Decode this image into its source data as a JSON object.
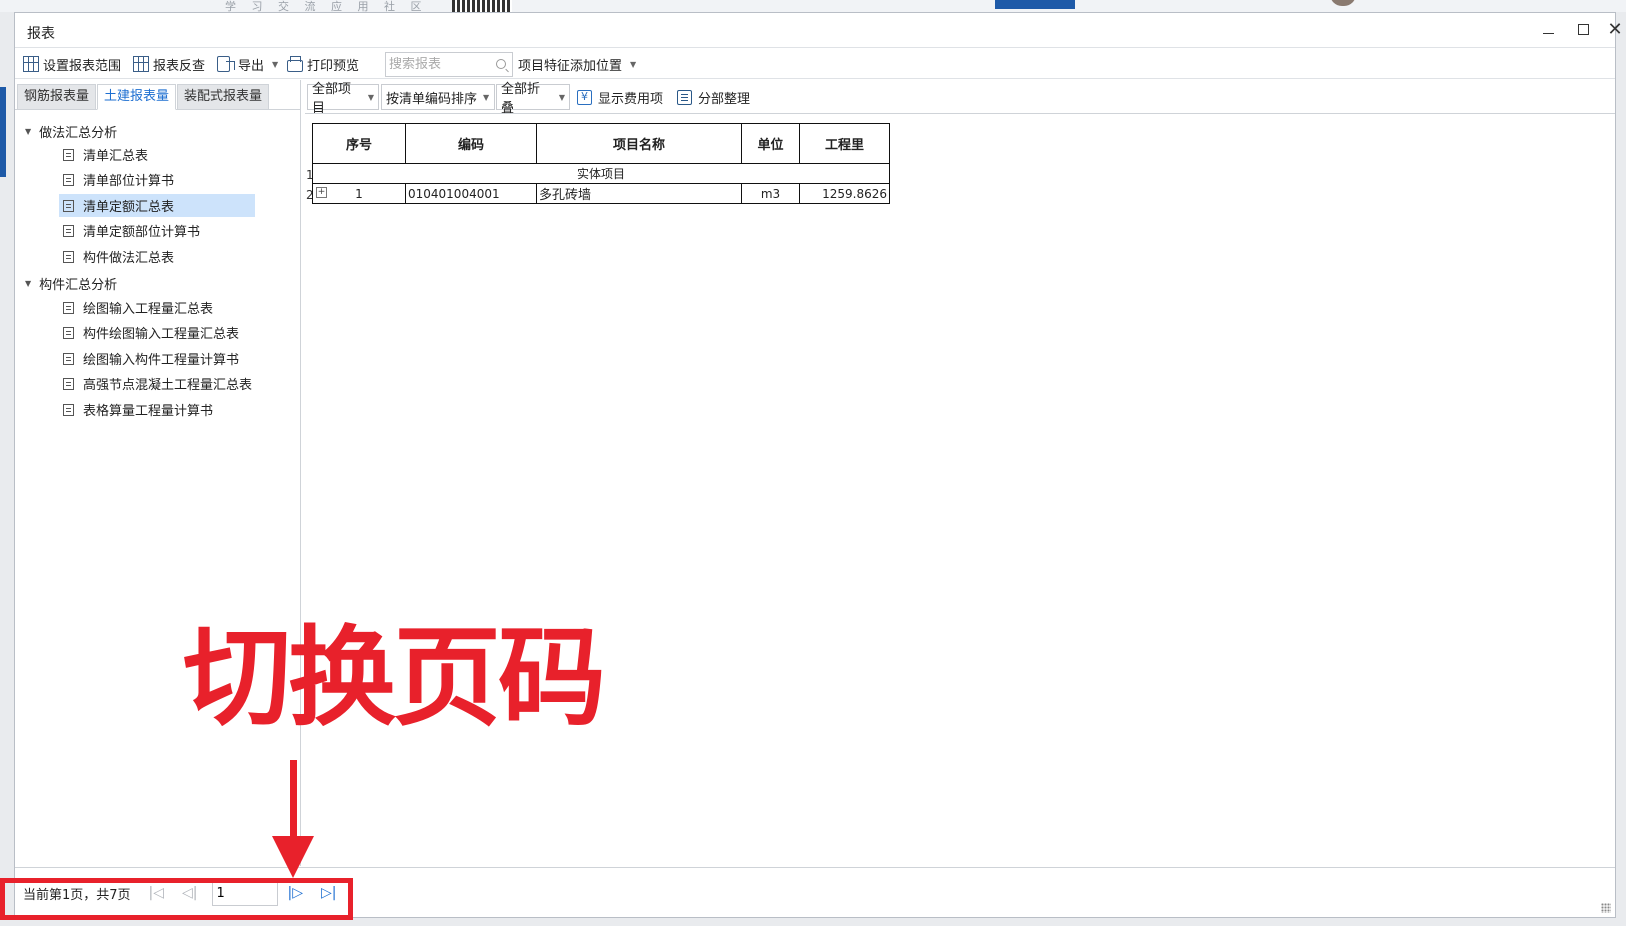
{
  "background": {
    "top_text": "学 习 交 流 应 用 社 区"
  },
  "window": {
    "title": "报表",
    "controls": {
      "minimize": "minimize",
      "maximize": "maximize",
      "close": "close"
    }
  },
  "toolbar": {
    "set_range": "设置报表范围",
    "reverse_check": "报表反查",
    "export": "导出",
    "print_preview": "打印预览",
    "search_placeholder": "搜索报表",
    "feature_position": "项目特征添加位置"
  },
  "tabs": [
    "钢筋报表量",
    "土建报表量",
    "装配式报表量"
  ],
  "tree": {
    "group1": {
      "label": "做法汇总分析",
      "items": [
        "清单汇总表",
        "清单部位计算书",
        "清单定额汇总表",
        "清单定额部位计算书",
        "构件做法汇总表"
      ]
    },
    "group2": {
      "label": "构件汇总分析",
      "items": [
        "绘图输入工程量汇总表",
        "构件绘图输入工程量汇总表",
        "绘图输入构件工程量计算书",
        "高强节点混凝土工程量汇总表",
        "表格算量工程量计算书"
      ]
    }
  },
  "subtoolbar": {
    "all_items": "全部项目",
    "sort_by_code": "按清单编码排序",
    "all_collapse": "全部折叠",
    "show_fees": "显示费用项",
    "section_arrange": "分部整理"
  },
  "report": {
    "headers": [
      "序号",
      "编码",
      "项目名称",
      "单位",
      "工程里"
    ],
    "section_row": {
      "num": "1",
      "label": "实体项目"
    },
    "data_row": {
      "num": "2",
      "seq": "1",
      "code": "010401004001",
      "name": "多孔砖墙",
      "unit": "m3",
      "qty": "1259.8626"
    }
  },
  "pager": {
    "status": "当前第1页，共7页",
    "page_value": "1"
  },
  "annotation": {
    "text": "切换页码",
    "color": "#e8212b"
  },
  "colors": {
    "accent": "#1e6fd1",
    "selection": "#cde3fb",
    "annotation_red": "#e8212b"
  }
}
